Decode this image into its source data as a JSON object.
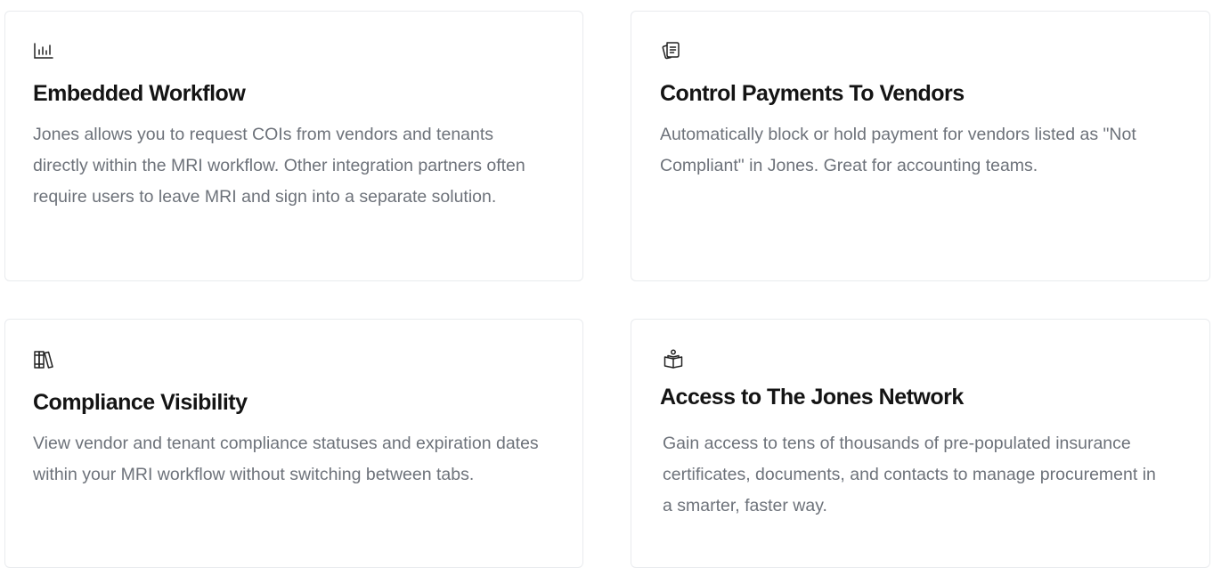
{
  "cards": [
    {
      "icon": "bar-chart-icon",
      "title": "Embedded Workflow",
      "text": "Jones allows you to request COIs from vendors and tenants directly within the MRI workflow. Other integration partners often require users to leave MRI and sign into a separate solution."
    },
    {
      "icon": "receipt-stack-icon",
      "title": "Control Payments To Vendors",
      "text": "Automatically block or hold payment for vendors listed as \"Not Compliant\" in Jones. Great for accounting teams."
    },
    {
      "icon": "books-icon",
      "title": "Compliance Visibility",
      "text": "View vendor and tenant compliance statuses and expiration dates within your MRI workflow without switching between tabs."
    },
    {
      "icon": "book-reader-icon",
      "title": "Access to The Jones Network",
      "text": "Gain access to tens of thousands of pre-populated insurance certificates, documents, and contacts to manage procurement in a smarter, faster way."
    }
  ]
}
